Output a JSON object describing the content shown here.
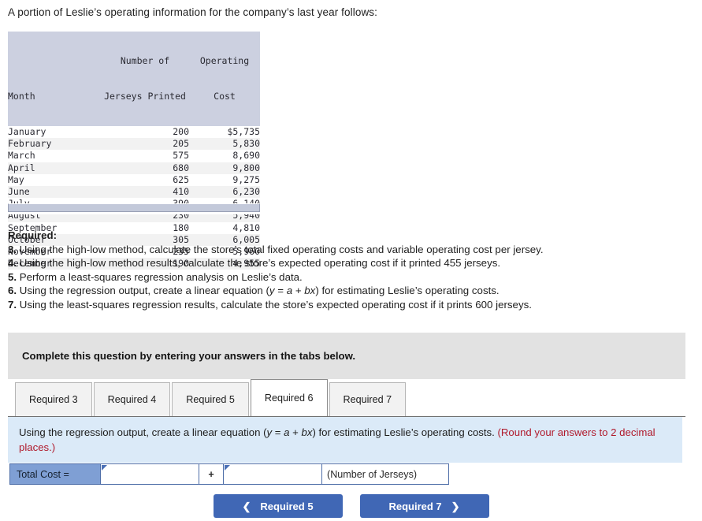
{
  "intro": "A portion of Leslie’s operating information for the company’s last year follows:",
  "table": {
    "headers": {
      "month": {
        "line1": "",
        "line2": "Month"
      },
      "units": {
        "line1": "Number of",
        "line2": "Jerseys Printed"
      },
      "cost": {
        "line1": "Operating",
        "line2": "Cost"
      }
    },
    "rows": [
      {
        "month": "January",
        "units": "200",
        "cost": "$5,735"
      },
      {
        "month": "February",
        "units": "205",
        "cost": "5,830"
      },
      {
        "month": "March",
        "units": "575",
        "cost": "8,690"
      },
      {
        "month": "April",
        "units": "680",
        "cost": "9,800"
      },
      {
        "month": "May",
        "units": "625",
        "cost": "9,275"
      },
      {
        "month": "June",
        "units": "410",
        "cost": "6,230"
      },
      {
        "month": "July",
        "units": "390",
        "cost": "6,140"
      },
      {
        "month": "August",
        "units": "230",
        "cost": "5,940"
      },
      {
        "month": "September",
        "units": "180",
        "cost": "4,810"
      },
      {
        "month": "October",
        "units": "305",
        "cost": "6,005"
      },
      {
        "month": "November",
        "units": "235",
        "cost": "5,960"
      },
      {
        "month": "December",
        "units": "190",
        "cost": "4,955"
      }
    ]
  },
  "required": {
    "heading": "Required:",
    "items": [
      {
        "num": "3.",
        "text": "Using the high-low method, calculate the store’s total fixed operating costs and variable operating cost per jersey."
      },
      {
        "num": "4.",
        "text": "Using the high-low method results, calculate the store’s expected operating cost if it printed 455 jerseys."
      },
      {
        "num": "5.",
        "text": "Perform a least-squares regression analysis on Leslie’s data."
      },
      {
        "num": "6.",
        "text": "Using the regression output, create a linear equation (y = a + bx) for estimating Leslie’s operating costs."
      },
      {
        "num": "7.",
        "text": "Using the least-squares regression results, calculate the store’s expected operating cost if it prints 600 jerseys."
      }
    ]
  },
  "banner": {
    "text": "Complete this question by entering your answers in the tabs below."
  },
  "tabs": [
    {
      "label": "Required 3",
      "active": false
    },
    {
      "label": "Required 4",
      "active": false
    },
    {
      "label": "Required 5",
      "active": false
    },
    {
      "label": "Required 6",
      "active": true
    },
    {
      "label": "Required 7",
      "active": false
    }
  ],
  "instruction": {
    "part1": "Using the regression output, create a linear equation (",
    "eq_y": "y",
    "eq_mid": " = ",
    "eq_a": "a",
    "eq_plus": " + ",
    "eq_bx": "bx",
    "part2": ") for estimating Leslie’s operating costs. ",
    "round_note": "(Round your answers to 2 decimal places.)"
  },
  "answer_row": {
    "label": "Total Cost =",
    "input1_value": "",
    "operator": "+",
    "input2_value": "",
    "note": "(Number of Jerseys)"
  },
  "nav": {
    "prev_label": "Required 5",
    "prev_icon": "chevron-left",
    "next_label": "Required 7",
    "next_icon": "chevron-right"
  },
  "colors": {
    "accent_button": "#4067b5",
    "panel_blue": "#dbeaf8",
    "label_blue": "#7f9fd4",
    "header_gray_blue": "#ccd0e0",
    "banner_gray": "#e2e2e2",
    "red_note": "#b01a2c"
  }
}
